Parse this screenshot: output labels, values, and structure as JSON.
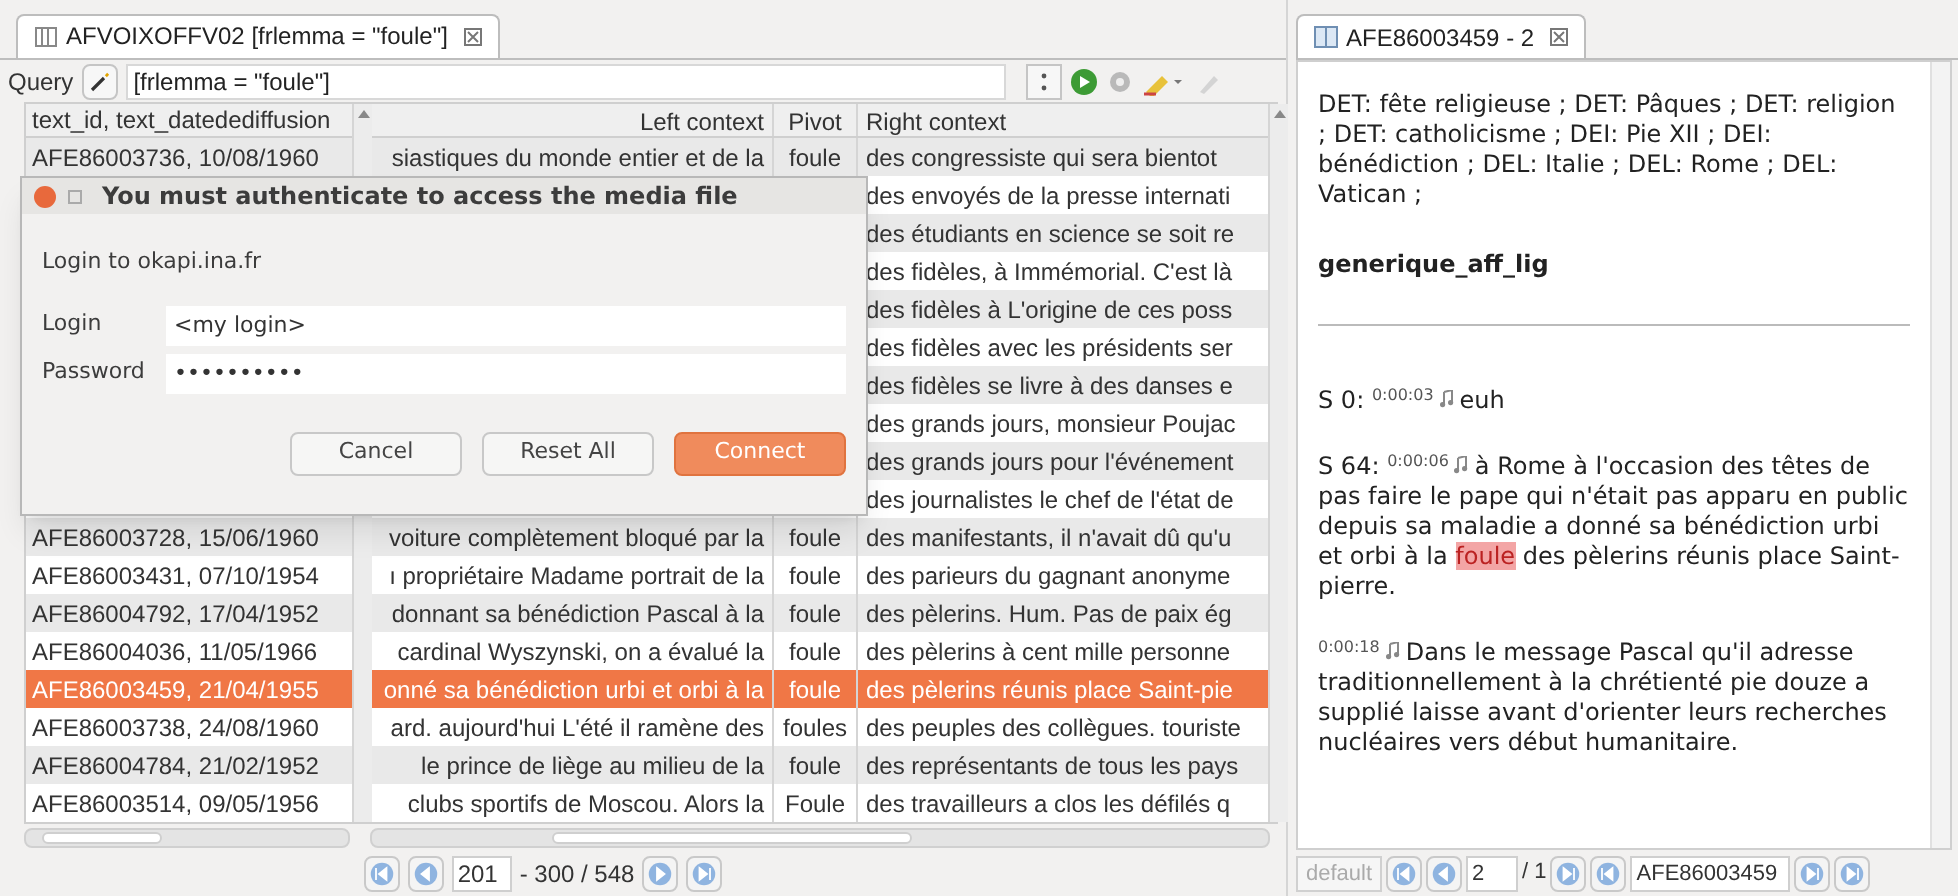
{
  "left_panel": {
    "tab": {
      "title": "AFVOIXOFFV02 [frlemma = \"foule\"]",
      "selected": true
    },
    "query": {
      "label": "Query",
      "value": "[frlemma = \"foule\"]"
    },
    "table": {
      "columns": [
        "text_id, text_datedediffusion",
        "Left context",
        "Pivot",
        "Right context"
      ],
      "rows": [
        {
          "id": "AFE86003736, 10/08/1960",
          "left": "siastiques du monde entier et de la",
          "pivot": "foule",
          "right": "des congressiste qui sera bientot",
          "selected": false
        },
        {
          "right": "des envoyés de la presse internati",
          "selected": false
        },
        {
          "right": "des étudiants en science se soit re",
          "selected": false
        },
        {
          "right": "des fidèles, à Immémorial. C'est là",
          "selected": false
        },
        {
          "right": "des fidèles à L'origine de ces poss",
          "selected": false
        },
        {
          "right": "des fidèles avec les présidents ser",
          "selected": false
        },
        {
          "right": "des fidèles se livre à des danses e",
          "selected": false
        },
        {
          "right": "des grands jours, monsieur Poujac",
          "selected": false
        },
        {
          "right": "des grands jours pour l'événement",
          "selected": false
        },
        {
          "right": "des journalistes le chef de l'état de",
          "selected": false
        },
        {
          "id": "AFE86003728, 15/06/1960",
          "left": "voiture complètement bloqué par la",
          "pivot": "foule",
          "right": "des manifestants, il n'avait dû qu'u",
          "selected": false
        },
        {
          "id": "AFE86003431, 07/10/1954",
          "left": "ı propriétaire Madame portrait de la",
          "pivot": "foule",
          "right": "des parieurs du gagnant anonyme",
          "selected": false
        },
        {
          "id": "AFE86004792, 17/04/1952",
          "left": "donnant sa bénédiction Pascal à la",
          "pivot": "foule",
          "right": "des pèlerins. Hum. Pas de paix ég",
          "selected": false
        },
        {
          "id": "AFE86004036, 11/05/1966",
          "left": "cardinal Wyszynski, on a évalué la",
          "pivot": "foule",
          "right": "des pèlerins à cent mille personne",
          "selected": false
        },
        {
          "id": "AFE86003459, 21/04/1955",
          "left": "onné sa bénédiction urbi et orbi à la",
          "pivot": "foule",
          "right": "des pèlerins réunis place Saint-pie",
          "selected": true
        },
        {
          "id": "AFE86003738, 24/08/1960",
          "left": "ard. aujourd'hui L'été il ramène des",
          "pivot": "foules",
          "right": "des peuples des collègues. touriste",
          "selected": false
        },
        {
          "id": "AFE86004784, 21/02/1952",
          "left": "le prince de liège au milieu de la",
          "pivot": "foule",
          "right": "des représentants de tous les pays",
          "selected": false
        },
        {
          "id": "AFE86003514, 09/05/1956",
          "left": "clubs sportifs de Moscou. Alors la",
          "pivot": "Foule",
          "right": "des travailleurs a clos les défilés q",
          "selected": false
        }
      ]
    },
    "pagination": {
      "value": "201",
      "range": "- 300 / 548"
    }
  },
  "dialog": {
    "title": "You must authenticate to access the media file",
    "message": "Login to okapi.ina.fr",
    "fields": [
      {
        "label": "Login",
        "value": "<my login>"
      },
      {
        "label": "Password",
        "value": "••••••••••"
      }
    ],
    "buttons": [
      {
        "label": "Cancel",
        "kind": "normal"
      },
      {
        "label": "Reset All",
        "kind": "normal"
      },
      {
        "label": "Connect",
        "kind": "default"
      }
    ]
  },
  "right_panel": {
    "tab": {
      "title": "AFE86003459 - 2",
      "selected": true
    },
    "metadata": "DET: fête religieuse ; DET: Pâques ; DET: religion ; DET: catholicisme ; DEI: Pie XII ; DEI: bénédiction ; DEL: Italie ; DEL: Rome ; DEL: Vatican ;",
    "section_heading": "generique_aff_lig",
    "segments": [
      {
        "speaker": "S 0:",
        "time": "0:00:03",
        "parts": [
          {
            "text": "euh",
            "highlighted": false
          }
        ]
      },
      {
        "speaker": "S 64:",
        "time": "0:00:06",
        "parts": [
          {
            "text": "à Rome à l'occasion des têtes de pas faire le pape qui n'était pas apparu en public depuis sa maladie a donné sa bénédiction urbi et orbi à la",
            "highlighted": false
          },
          {
            "text": "foule",
            "highlighted": true
          },
          {
            "text": "des pèlerins réunis place Saint-pierre.",
            "highlighted": false
          }
        ]
      },
      {
        "time": "0:00:18",
        "parts": [
          {
            "text": "Dans le message Pascal qu'il adresse traditionnellement à la chrétienté pie douze a supplié laisse avant d'orienter leurs recherches nucléaires vers début humanitaire.",
            "highlighted": false
          }
        ]
      }
    ],
    "footer": {
      "layer": "default",
      "page": "2",
      "total": "/ 1",
      "document": "AFE86003459"
    }
  }
}
